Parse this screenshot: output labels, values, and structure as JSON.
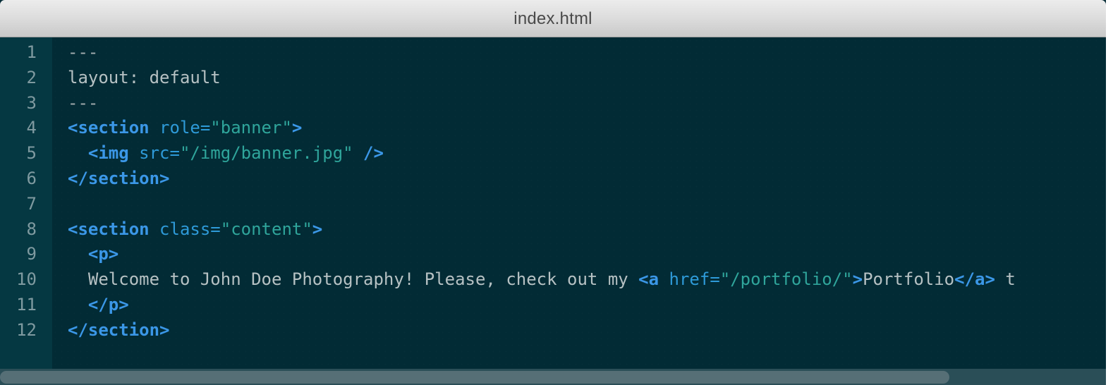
{
  "window": {
    "title": "index.html"
  },
  "editor": {
    "lines": [
      {
        "number": "1",
        "parts": [
          {
            "type": "dash",
            "text": "---"
          }
        ]
      },
      {
        "number": "2",
        "parts": [
          {
            "type": "txt",
            "text": "layout: default"
          }
        ]
      },
      {
        "number": "3",
        "parts": [
          {
            "type": "dash",
            "text": "---"
          }
        ]
      },
      {
        "number": "4",
        "parts": [
          {
            "type": "tag",
            "text": "<section"
          },
          {
            "type": "space",
            "text": " "
          },
          {
            "type": "attr",
            "text": "role="
          },
          {
            "type": "val",
            "text": "\"banner\""
          },
          {
            "type": "tag",
            "text": ">"
          }
        ]
      },
      {
        "number": "5",
        "parts": [
          {
            "type": "space",
            "text": "  "
          },
          {
            "type": "tag",
            "text": "<img"
          },
          {
            "type": "space",
            "text": " "
          },
          {
            "type": "attr",
            "text": "src="
          },
          {
            "type": "val",
            "text": "\"/img/banner.jpg\""
          },
          {
            "type": "space",
            "text": " "
          },
          {
            "type": "tag",
            "text": "/>"
          }
        ]
      },
      {
        "number": "6",
        "parts": [
          {
            "type": "tag",
            "text": "</section>"
          }
        ]
      },
      {
        "number": "7",
        "parts": []
      },
      {
        "number": "8",
        "parts": [
          {
            "type": "tag",
            "text": "<section"
          },
          {
            "type": "space",
            "text": " "
          },
          {
            "type": "attr",
            "text": "class="
          },
          {
            "type": "val",
            "text": "\"content\""
          },
          {
            "type": "tag",
            "text": ">"
          }
        ]
      },
      {
        "number": "9",
        "parts": [
          {
            "type": "space",
            "text": "  "
          },
          {
            "type": "tag",
            "text": "<p>"
          }
        ]
      },
      {
        "number": "10",
        "parts": [
          {
            "type": "space",
            "text": "  "
          },
          {
            "type": "txt",
            "text": "Welcome to John Doe Photography! Please, check out my "
          },
          {
            "type": "tag",
            "text": "<a"
          },
          {
            "type": "space",
            "text": " "
          },
          {
            "type": "attr",
            "text": "href="
          },
          {
            "type": "val",
            "text": "\"/portfolio/\""
          },
          {
            "type": "tag",
            "text": ">"
          },
          {
            "type": "txt",
            "text": "Portfolio"
          },
          {
            "type": "tag",
            "text": "</a>"
          },
          {
            "type": "space",
            "text": " "
          },
          {
            "type": "txt",
            "text": "t"
          }
        ]
      },
      {
        "number": "11",
        "parts": [
          {
            "type": "space",
            "text": "  "
          },
          {
            "type": "tag",
            "text": "</p>"
          }
        ]
      },
      {
        "number": "12",
        "parts": [
          {
            "type": "tag",
            "text": "</section>"
          }
        ]
      }
    ]
  },
  "colors": {
    "background": "#022b35",
    "gutter": "#053842",
    "tag": "#3b97e7",
    "attribute": "#2e9ad8",
    "string": "#2fa59b",
    "text": "#b6c1c3"
  }
}
